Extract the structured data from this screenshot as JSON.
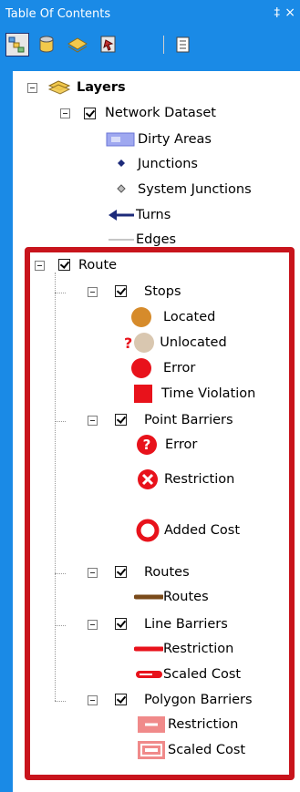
{
  "panel": {
    "title": "Table Of Contents",
    "pin_glyph": "‡",
    "close_glyph": "×"
  },
  "colors": {
    "accent": "#1a8ae6",
    "highlight": "#c8141c",
    "stop_located": "#d68b2b",
    "stop_unlocated": "#d9c7b0",
    "error_red": "#e8121b",
    "route_brown": "#7a4a1a",
    "barrier_pink": "#f08a8a"
  },
  "tree": {
    "layers": "Layers",
    "network_dataset": "Network Dataset",
    "dirty_areas": "Dirty Areas",
    "junctions": "Junctions",
    "system_junctions": "System Junctions",
    "turns": "Turns",
    "edges": "Edges",
    "route": "Route",
    "stops": {
      "label": "Stops",
      "located": "Located",
      "unlocated": "Unlocated",
      "unlocated_mark": "?",
      "error": "Error",
      "time_violation": "Time Violation"
    },
    "point_barriers": {
      "label": "Point Barriers",
      "error": "Error",
      "error_mark": "?",
      "restriction": "Restriction",
      "added_cost": "Added Cost"
    },
    "routes": {
      "label": "Routes",
      "routes": "Routes"
    },
    "line_barriers": {
      "label": "Line Barriers",
      "restriction": "Restriction",
      "scaled_cost": "Scaled Cost"
    },
    "polygon_barriers": {
      "label": "Polygon Barriers",
      "restriction": "Restriction",
      "scaled_cost": "Scaled Cost"
    }
  }
}
